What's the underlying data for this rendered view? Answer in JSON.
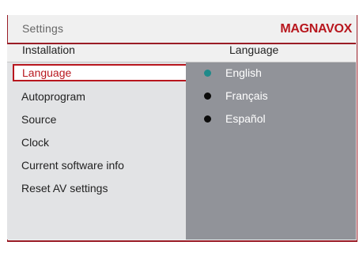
{
  "header": {
    "breadcrumb": "Settings",
    "brand": "MAGNAVOX"
  },
  "left": {
    "title": "Installation",
    "items": [
      {
        "label": "Language",
        "selected": true
      },
      {
        "label": "Autoprogram"
      },
      {
        "label": "Source"
      },
      {
        "label": "Clock"
      },
      {
        "label": "Current software info"
      },
      {
        "label": "Reset AV settings"
      }
    ]
  },
  "right": {
    "title": "Language",
    "options": [
      {
        "label": "English",
        "active": true
      },
      {
        "label": "Français"
      },
      {
        "label": "Español"
      }
    ]
  },
  "colors": {
    "accent": "#b8171e",
    "active_dot": "#1f8a8a",
    "right_panel": "#919399"
  }
}
